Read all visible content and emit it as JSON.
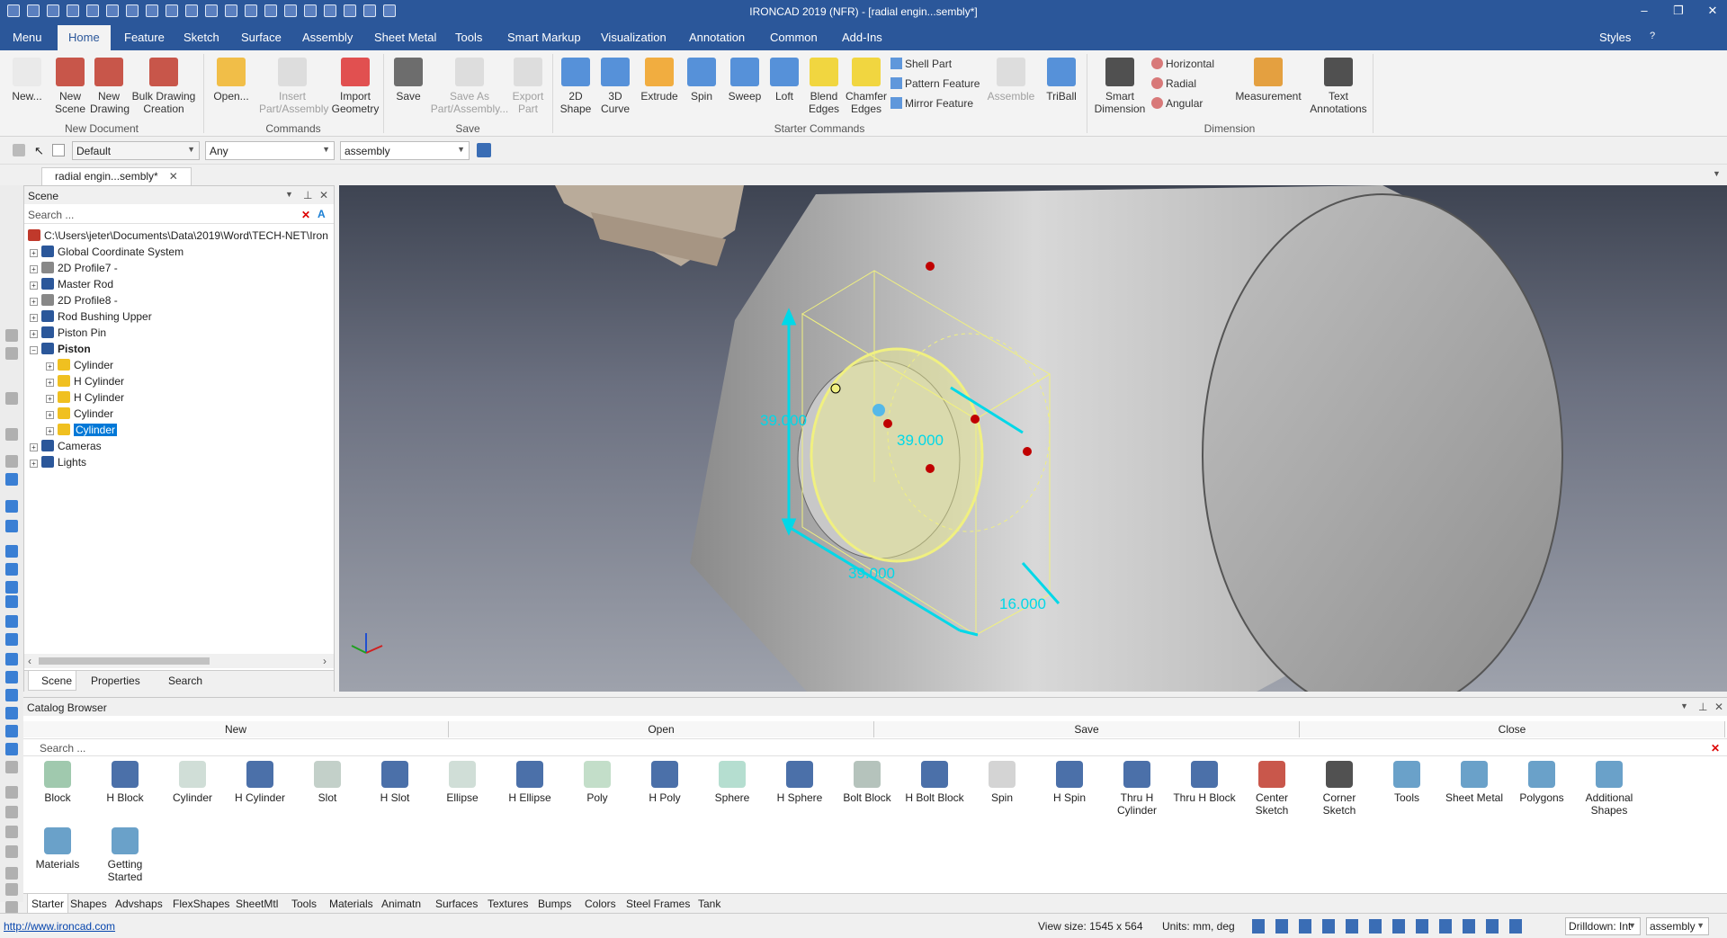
{
  "window": {
    "title": "IRONCAD 2019 (NFR) - [radial engin...sembly*]",
    "style_label": "Styles"
  },
  "ribbon_tabs": [
    "Menu",
    "Home",
    "Feature",
    "Sketch",
    "Surface",
    "Assembly",
    "Sheet Metal",
    "Tools",
    "Smart Markup",
    "Visualization",
    "Annotation",
    "Common",
    "Add-Ins"
  ],
  "ribbon": {
    "new_document": {
      "group": "New Document",
      "buttons": [
        [
          "New..."
        ],
        [
          "New",
          "Scene"
        ],
        [
          "New",
          "Drawing"
        ],
        [
          "Bulk Drawing",
          "Creation"
        ]
      ]
    },
    "commands": {
      "group": "Commands",
      "buttons": [
        [
          "Open..."
        ],
        [
          "Insert",
          "Part/Assembly"
        ],
        [
          "Import",
          "Geometry"
        ]
      ]
    },
    "save": {
      "group": "Save",
      "buttons": [
        [
          "Save"
        ],
        [
          "Save As",
          "Part/Assembly..."
        ],
        [
          "Export",
          "Part"
        ]
      ]
    },
    "starter": {
      "group": "Starter Commands",
      "buttons": [
        [
          "2D",
          "Shape"
        ],
        [
          "3D",
          "Curve"
        ],
        [
          "Extrude"
        ],
        [
          "Spin"
        ],
        [
          "Sweep"
        ],
        [
          "Loft"
        ],
        [
          "Blend",
          "Edges"
        ],
        [
          "Chamfer",
          "Edges"
        ]
      ],
      "small": [
        "Shell Part",
        "Pattern Feature",
        "Mirror Feature"
      ],
      "after": [
        [
          "Assemble"
        ],
        [
          "TriBall"
        ]
      ]
    },
    "dimension": {
      "group": "Dimension",
      "buttons": [
        [
          "Smart",
          "Dimension"
        ]
      ],
      "small": [
        "Horizontal",
        "Radial",
        "Angular"
      ],
      "after": [
        [
          "Measurement"
        ],
        [
          "Text",
          "Annotations"
        ]
      ]
    }
  },
  "toolbar": {
    "style": "Default",
    "filter": "Any",
    "mode": "assembly"
  },
  "doc_tab": "radial engin...sembly*",
  "scene": {
    "title": "Scene",
    "search_placeholder": "Search ...",
    "root": "C:\\Users\\jeter\\Documents\\Data\\2019\\Word\\TECH-NET\\Iron",
    "items": [
      {
        "label": "Global Coordinate System",
        "level": 1,
        "bold": false
      },
      {
        "label": "2D Profile7 -",
        "level": 1,
        "bold": false
      },
      {
        "label": "Master Rod",
        "level": 1,
        "bold": false
      },
      {
        "label": "2D Profile8 -",
        "level": 1,
        "bold": false
      },
      {
        "label": "Rod Bushing Upper",
        "level": 1,
        "bold": false
      },
      {
        "label": "Piston Pin",
        "level": 1,
        "bold": false
      },
      {
        "label": "Piston",
        "level": 1,
        "bold": true
      },
      {
        "label": "Cylinder",
        "level": 2,
        "bold": false
      },
      {
        "label": "H Cylinder",
        "level": 2,
        "bold": false
      },
      {
        "label": "H Cylinder",
        "level": 2,
        "bold": false
      },
      {
        "label": "Cylinder",
        "level": 2,
        "bold": false
      },
      {
        "label": "Cylinder",
        "level": 2,
        "bold": false,
        "selected": true
      },
      {
        "label": "Cameras",
        "level": 1,
        "bold": false
      },
      {
        "label": "Lights",
        "level": 1,
        "bold": false
      }
    ],
    "footer_tabs": [
      "Scene",
      "Properties",
      "Search"
    ]
  },
  "viewport": {
    "dimensions": [
      "39.000",
      "39.000",
      "39.000",
      "16.000"
    ]
  },
  "catalog": {
    "title": "Catalog Browser",
    "buttons": [
      "New",
      "Open",
      "Save",
      "Close"
    ],
    "search_placeholder": "Search ...",
    "items": [
      [
        "Block"
      ],
      [
        "H Block"
      ],
      [
        "Cylinder"
      ],
      [
        "H Cylinder"
      ],
      [
        "Slot"
      ],
      [
        "H Slot"
      ],
      [
        "Ellipse"
      ],
      [
        "H Ellipse"
      ],
      [
        "Poly"
      ],
      [
        "H Poly"
      ],
      [
        "Sphere"
      ],
      [
        "H Sphere"
      ],
      [
        "Bolt Block"
      ],
      [
        "H Bolt Block"
      ],
      [
        "Spin"
      ],
      [
        "H Spin"
      ],
      [
        "Thru H",
        "Cylinder"
      ],
      [
        "Thru H Block"
      ],
      [
        "Center",
        "Sketch"
      ],
      [
        "Corner",
        "Sketch"
      ],
      [
        "Tools"
      ],
      [
        "Sheet Metal"
      ],
      [
        "Polygons"
      ],
      [
        "Additional",
        "Shapes"
      ],
      [
        "Materials"
      ],
      [
        "Getting",
        "Started"
      ]
    ],
    "tabs": [
      "Starter",
      "Shapes",
      "Advshaps",
      "FlexShapes",
      "SheetMtl",
      "Tools",
      "Materials",
      "Animatn",
      "Surfaces",
      "Textures",
      "Bumps",
      "Colors",
      "Steel Frames",
      "Tank"
    ]
  },
  "status": {
    "link": "http://www.ironcad.com",
    "view_size": "View size: 1545 x  564",
    "units": "Units: mm, deg",
    "drilldown": "Drilldown: Int",
    "assembly": "assembly"
  },
  "colors": {
    "accent": "#2b579a",
    "selection": "#0078d7",
    "dimension": "#00d8e8",
    "sketch": "#f0f080"
  }
}
